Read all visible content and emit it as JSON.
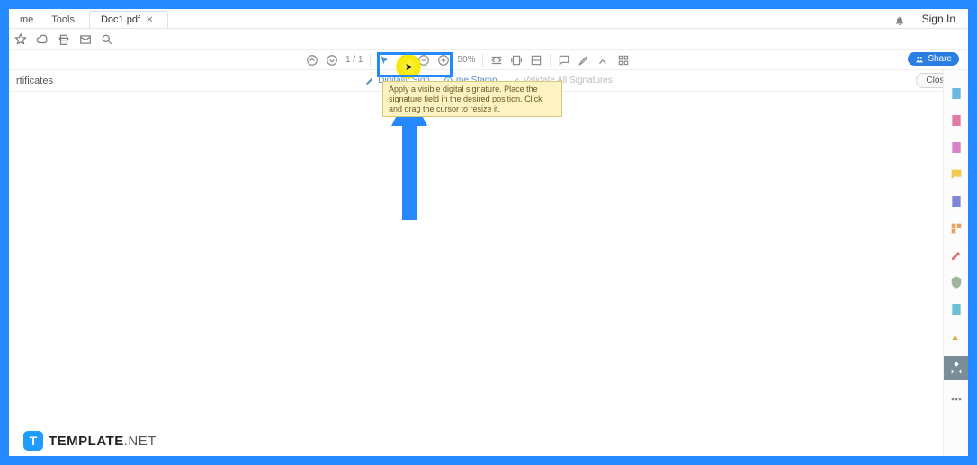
{
  "tabs": {
    "home": "me",
    "tools": "Tools",
    "doc": "Doc1.pdf"
  },
  "signin": "Sign In",
  "share": "Share",
  "toolbar": {
    "page": "1 / 1",
    "zoom": "50%"
  },
  "certbar": {
    "label": "rtificates",
    "digitally_sign": "Digitally Sign",
    "time_stamp": "me Stamp",
    "validate": "Validate All Signatures",
    "close": "Close"
  },
  "tooltip": "Apply a visible digital signature. Place the signature field in the desired position. Click and drag the cursor to resize it.",
  "watermark": {
    "badge": "T",
    "brand_bold": "TEMPLATE",
    "brand_light": ".NET"
  }
}
